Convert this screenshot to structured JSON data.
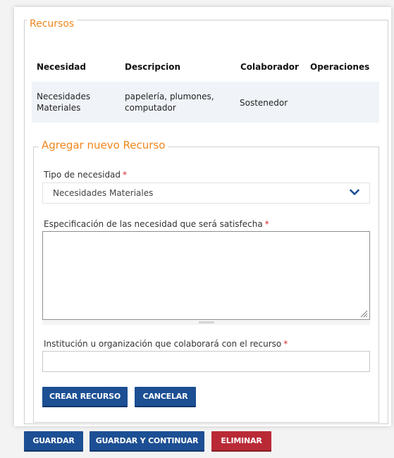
{
  "resources": {
    "legend": "Recursos",
    "columns": [
      "Necesidad",
      "Descripcion",
      "Colaborador",
      "Operaciones"
    ],
    "rows": [
      {
        "necesidad": [
          "Necesidades",
          "Materiales"
        ],
        "descripcion": [
          "papelería, plumones,",
          "computador"
        ],
        "colaborador": "Sostenedor",
        "operaciones": ""
      }
    ]
  },
  "form": {
    "legend": "Agregar nuevo Recurso",
    "tipo_label": "Tipo de necesidad",
    "tipo_value": "Necesidades Materiales",
    "especificacion_label": "Especificación de las necesidad que será satisfecha",
    "especificacion_value": "",
    "institucion_label": "Institución u organización que colaborará con el recurso",
    "institucion_value": "",
    "required_mark": "*",
    "create_button": "CREAR RECURSO",
    "cancel_button": "CANCELAR"
  },
  "actions": {
    "save": "GUARDAR",
    "save_continue": "GUARDAR Y CONTINUAR",
    "delete": "ELIMINAR"
  },
  "colors": {
    "legend_orange": "#f0861d",
    "primary_blue": "#1c4f93",
    "danger_red": "#b92a36",
    "row_highlight": "#f0f4f9",
    "required_red": "#d9262a"
  },
  "icons": {
    "select_arrow": "chevron-down-icon",
    "textarea_resize": "resize-grip-icon"
  }
}
